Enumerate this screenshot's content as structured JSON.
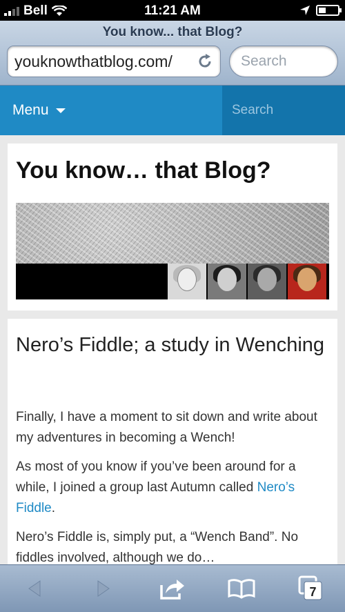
{
  "status_bar": {
    "carrier": "Bell",
    "time": "11:21 AM"
  },
  "browser": {
    "page_title": "You know... that Blog?",
    "url": "youknowthatblog.com/",
    "search_placeholder": "Search",
    "tab_count": "7"
  },
  "site_nav": {
    "menu_label": "Menu",
    "search_label": "Search"
  },
  "header": {
    "site_title": "You know… that Blog?"
  },
  "post": {
    "title": "Nero’s Fiddle; a study in Wenching",
    "paragraph1": "Finally, I have a moment to sit down and write about my adventures in becoming a Wench!",
    "paragraph2_before": "As most of you know if you’ve been around for a while, I joined a group last Autumn called ",
    "paragraph2_link": "Nero’s Fiddle",
    "paragraph2_after": ".",
    "paragraph3": "Nero’s Fiddle is, simply put, a “Wench Band”. No fiddles involved, although we do…"
  },
  "colors": {
    "nav_blue": "#1f8ac5",
    "nav_search_bg": "#1374ab",
    "link": "#1f8ac5"
  },
  "icons": {
    "back": "back-arrow-icon",
    "forward": "forward-arrow-icon",
    "share": "share-icon",
    "bookmarks": "bookmarks-icon",
    "tabs": "tabs-icon",
    "reload": "reload-icon",
    "location": "location-arrow-icon",
    "battery": "battery-icon",
    "wifi": "wifi-icon",
    "signal": "signal-bars-icon"
  }
}
